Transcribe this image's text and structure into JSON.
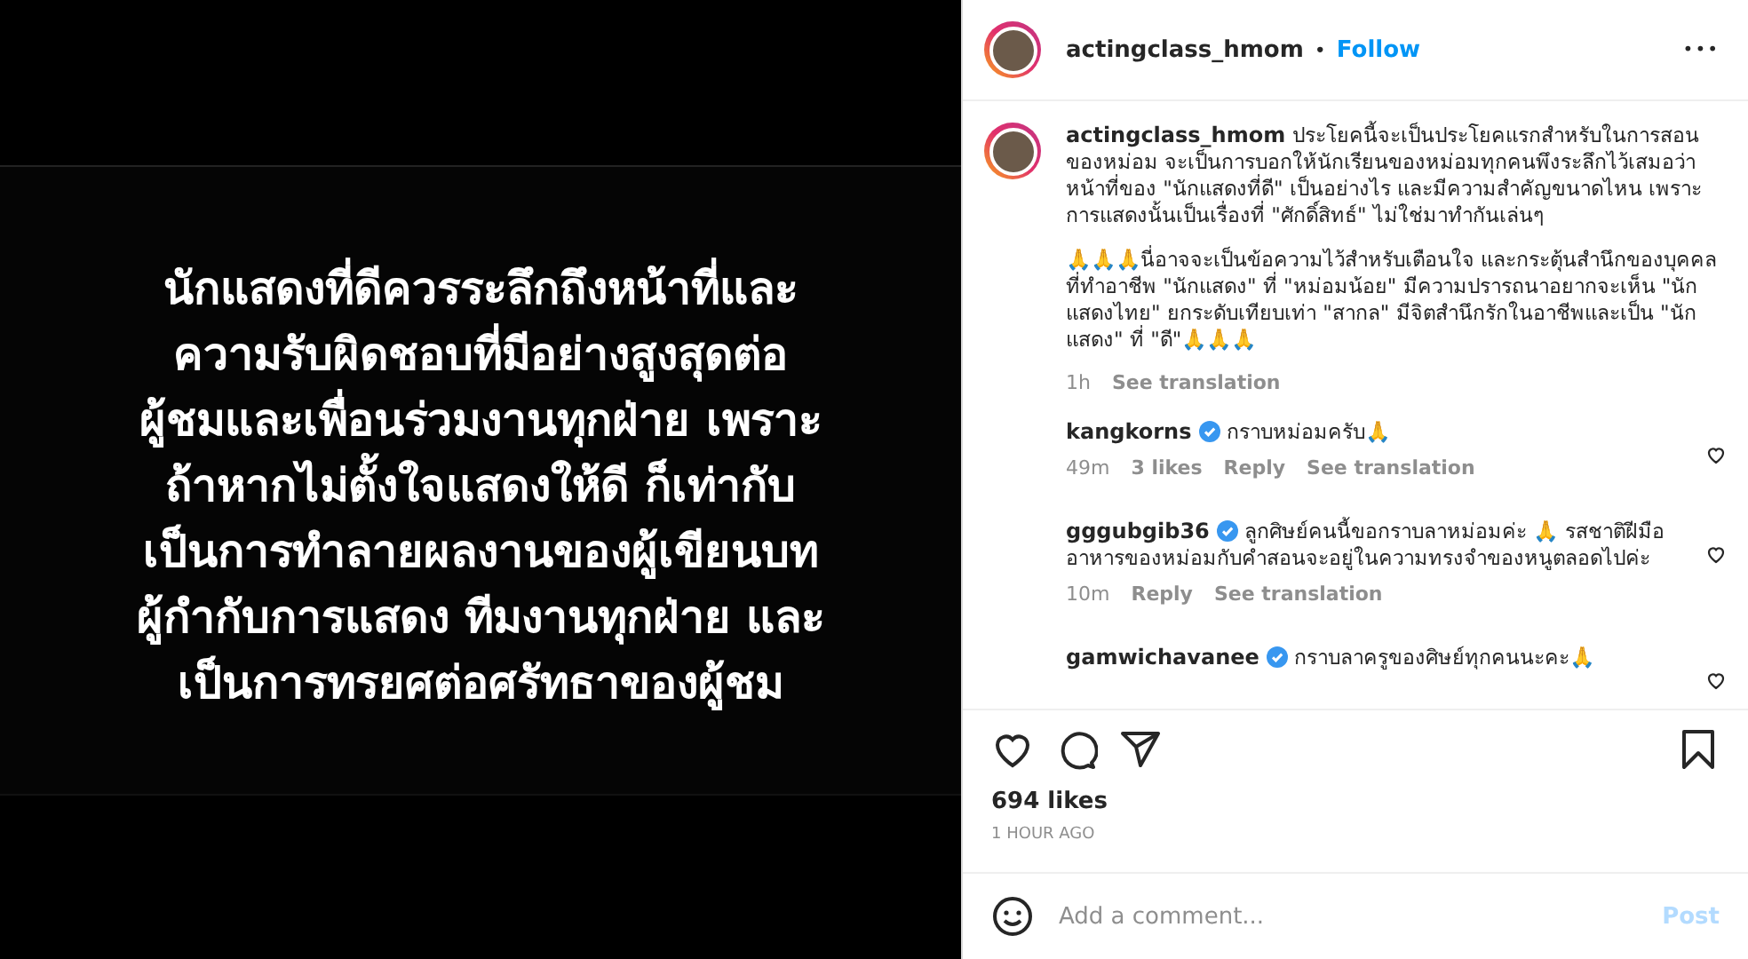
{
  "media": {
    "caption_lines": [
      "นักแสดงที่ดีควรระลึกถึงหน้าที่และ",
      "ความรับผิดชอบที่มีอย่างสูงสุดต่อ",
      "ผู้ชมและเพื่อนร่วมงานทุกฝ่าย เพราะ",
      "ถ้าหากไม่ตั้งใจแสดงให้ดี ก็เท่ากับ",
      "เป็นการทำลายผลงานของผู้เขียนบท",
      "ผู้กำกับการแสดง ทีมงานทุกฝ่าย และ",
      "เป็นการทรยศต่อศรัทธาของผู้ชม"
    ]
  },
  "header": {
    "username": "actingclass_hmom",
    "separator": "•",
    "follow": "Follow",
    "more": "•••"
  },
  "post": {
    "username": "actingclass_hmom",
    "paragraphs": [
      "ประโยคนี้จะเป็นประโยคแรกสำหรับในการสอนของหม่อม จะเป็นการบอกให้นักเรียนของหม่อมทุกคนพึงระลึกไว้เสมอว่าหน้าที่ของ \"นักแสดงที่ดี\" เป็นอย่างไร และมีความสำคัญขนาดไหน เพราะการแสดงนั้นเป็นเรื่องที่ \"ศักดิ์สิทธ์\" ไม่ใช่มาทำกันเล่นๆ",
      "🙏🙏🙏นี่อาจจะเป็นข้อความไว้สำหรับเตือนใจ และกระตุ้นสำนึกของบุคคลที่ทำอาชีพ \"นักแสดง\" ที่ \"หม่อมน้อย\" มีความปรารถนาอยากจะเห็น \"นักแสดงไทย\" ยกระดับเทียบเท่า \"สากล\"  มีจิตสำนึกรักในอาชีพและเป็น \"นักแสดง\" ที่ \"ดี\"🙏🙏🙏"
    ],
    "time": "1h",
    "translate": "See translation"
  },
  "comments": [
    {
      "username": "kangkorns",
      "verified": true,
      "text": "กราบหม่อมครับ🙏",
      "time": "49m",
      "likes": "3 likes",
      "reply": "Reply",
      "translate": "See translation"
    },
    {
      "username": "gggubgib36",
      "verified": true,
      "text": "ลูกศิษย์คนนี้ขอกราบลาหม่อมค่ะ 🙏 รสชาติฝีมืออาหารของหม่อมกับคำสอนจะอยู่ในความทรงจำของหนูตลอดไปค่ะ",
      "time": "10m",
      "reply": "Reply",
      "translate": "See translation"
    },
    {
      "username": "gamwichavanee",
      "verified": true,
      "text": "กราบลาครูของศิษย์ทุกคนนะคะ🙏"
    }
  ],
  "likes": "694 likes",
  "posted": "1 HOUR AGO",
  "comment_box": {
    "placeholder": "Add a comment...",
    "post": "Post"
  }
}
